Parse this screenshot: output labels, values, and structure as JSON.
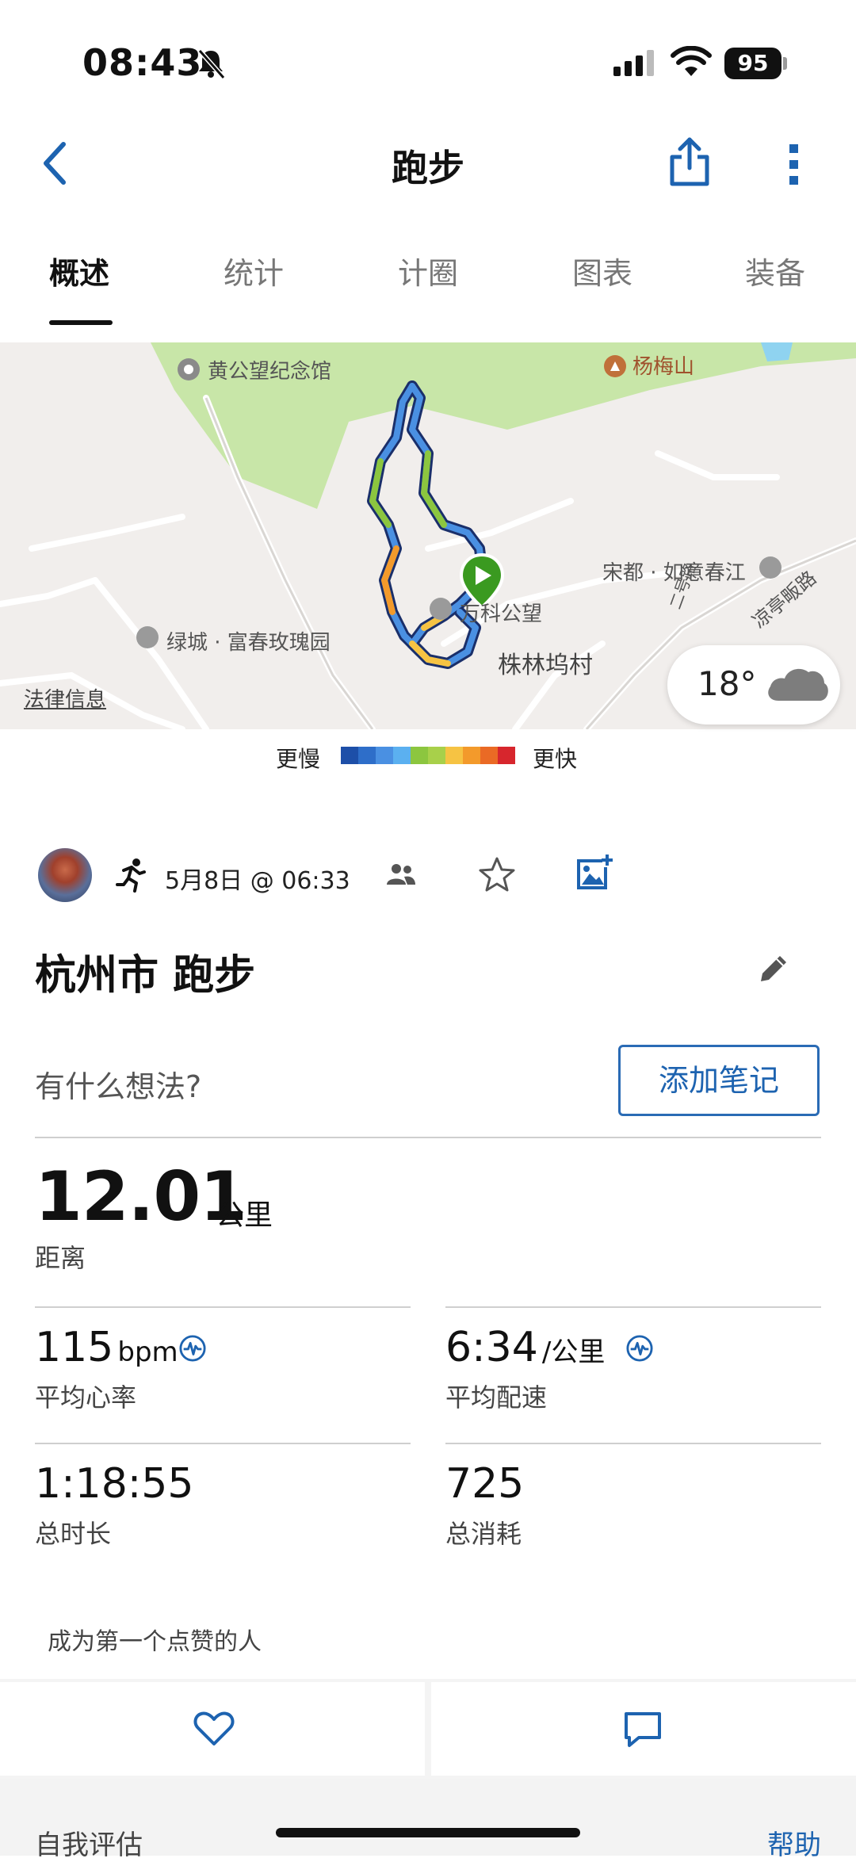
{
  "status": {
    "time": "08:43",
    "battery": "95"
  },
  "nav": {
    "title": "跑步"
  },
  "tabs": [
    "概述",
    "统计",
    "计圈",
    "图表",
    "装备"
  ],
  "map": {
    "labels": {
      "huanggongwang": "黄公望纪念馆",
      "yangmeishan": "杨梅山",
      "songdu": "宋都 · 如意春江",
      "lvcheng": "绿城 · 富春玫瑰园",
      "vanke": "万科公望",
      "zhulin": "株林坞村",
      "road1": "凉亭畈路",
      "road2": "二号路"
    },
    "legal": "法律信息",
    "weather_temp": "18°"
  },
  "legend": {
    "slow": "更慢",
    "fast": "更快",
    "colors": [
      "#1d4fa8",
      "#2e6ec9",
      "#4a90e2",
      "#5bb0f0",
      "#8cc63f",
      "#a8d04a",
      "#f6c343",
      "#f39a2b",
      "#ea6a25",
      "#d7262d"
    ]
  },
  "activity": {
    "datetime": "5月8日 @ 06:33",
    "title": "杭州市 跑步",
    "note_prompt": "有什么想法?",
    "add_note": "添加笔记"
  },
  "stats": {
    "distance": {
      "value": "12.01",
      "unit": "公里",
      "label": "距离"
    },
    "heart_rate": {
      "value": "115",
      "unit": "bpm",
      "label": "平均心率"
    },
    "pace": {
      "value": "6:34",
      "unit": "/公里",
      "label": "平均配速"
    },
    "duration": {
      "value": "1:18:55",
      "label": "总时长"
    },
    "calories": {
      "value": "725",
      "label": "总消耗"
    }
  },
  "social": {
    "likes_text": "成为第一个点赞的人"
  },
  "footer": {
    "self_eval": "自我评估",
    "help": "帮助"
  },
  "colors": {
    "accent": "#1d63b0",
    "map_green": "#c8e6a8"
  }
}
